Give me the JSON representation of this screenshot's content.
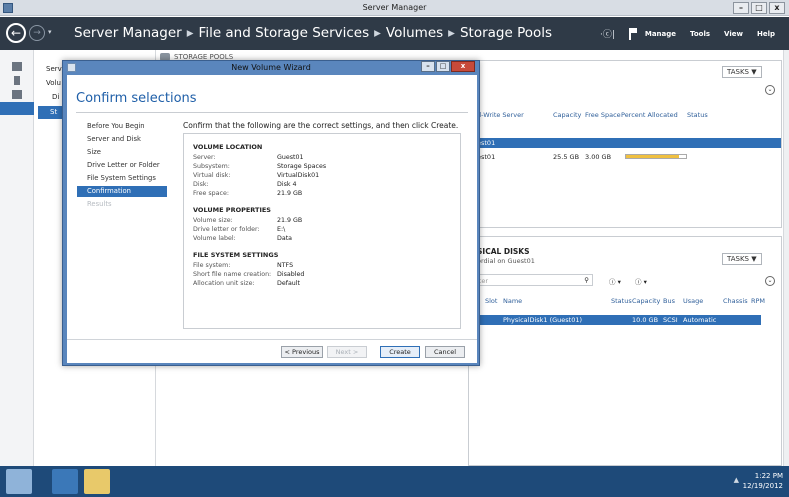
{
  "window": {
    "title": "Server Manager",
    "controls": {
      "minimize": "–",
      "restore": "□",
      "close": "x"
    }
  },
  "nav": {
    "breadcrumb": [
      "Server Manager",
      "File and Storage Services",
      "Volumes",
      "Storage Pools"
    ],
    "separator": "▸",
    "manage": "Manage",
    "tools": "Tools",
    "view": "View",
    "help": "Help"
  },
  "subnav": {
    "items": [
      "Serv",
      "Volu",
      "Di",
      "St"
    ]
  },
  "storage_pools": {
    "header": "STORAGE POOLS",
    "tasks": "TASKS",
    "columns": [
      "d-Write Server",
      "Capacity",
      "Free Space",
      "Percent Allocated",
      "Status"
    ],
    "selected_row": "est01",
    "row": {
      "server": "est01",
      "capacity": "25.5 GB",
      "free_space": "3.00 GB",
      "percent_allocated": 0.88
    }
  },
  "physical_disks": {
    "header": "SICAL DISKS",
    "subheader": "ordial on Guest01",
    "tasks": "TASKS",
    "filter_placeholder": "lter",
    "columns": [
      "Slot",
      "Name",
      "Status",
      "Capacity",
      "Bus",
      "Usage",
      "Chassis",
      "RPM"
    ],
    "row": {
      "name": "PhysicalDisk1 (Guest01)",
      "capacity": "10.0 GB",
      "bus": "SCSI",
      "usage": "Automatic"
    }
  },
  "wizard": {
    "title": "New Volume Wizard",
    "heading": "Confirm selections",
    "steps": [
      {
        "label": "Before You Begin",
        "state": "done"
      },
      {
        "label": "Server and Disk",
        "state": "done"
      },
      {
        "label": "Size",
        "state": "done"
      },
      {
        "label": "Drive Letter or Folder",
        "state": "done"
      },
      {
        "label": "File System Settings",
        "state": "done"
      },
      {
        "label": "Confirmation",
        "state": "active"
      },
      {
        "label": "Results",
        "state": "disabled"
      }
    ],
    "instruction": "Confirm that the following are the correct settings, and then click Create.",
    "sections": [
      {
        "title": "VOLUME LOCATION",
        "rows": [
          {
            "label": "Server:",
            "value": "Guest01"
          },
          {
            "label": "Subsystem:",
            "value": "Storage Spaces"
          },
          {
            "label": "Virtual disk:",
            "value": "VirtualDisk01"
          },
          {
            "label": "Disk:",
            "value": "Disk 4"
          },
          {
            "label": "Free space:",
            "value": "21.9 GB"
          }
        ]
      },
      {
        "title": "VOLUME PROPERTIES",
        "rows": [
          {
            "label": "Volume size:",
            "value": "21.9 GB"
          },
          {
            "label": "Drive letter or folder:",
            "value": "E:\\"
          },
          {
            "label": "Volume label:",
            "value": "Data"
          }
        ]
      },
      {
        "title": "FILE SYSTEM SETTINGS",
        "rows": [
          {
            "label": "File system:",
            "value": "NTFS"
          },
          {
            "label": "Short file name creation:",
            "value": "Disabled"
          },
          {
            "label": "Allocation unit size:",
            "value": "Default"
          }
        ]
      }
    ],
    "buttons": {
      "previous": "< Previous",
      "next": "Next >",
      "create": "Create",
      "cancel": "Cancel"
    }
  },
  "taskbar": {
    "time": "1:22 PM",
    "date": "12/19/2012",
    "tray_chevron": "▲"
  }
}
